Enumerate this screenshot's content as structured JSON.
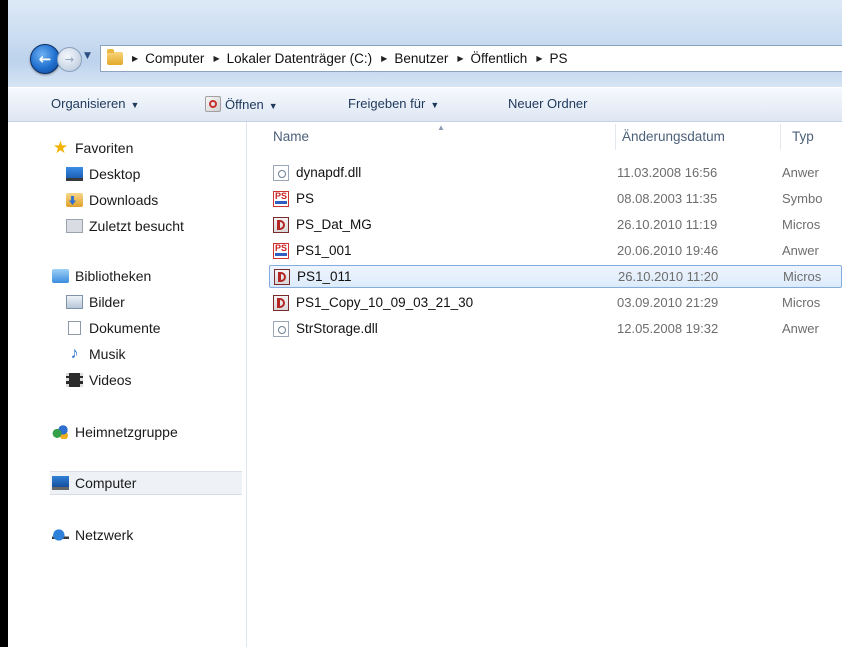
{
  "breadcrumb": [
    "Computer",
    "Lokaler Datenträger (C:)",
    "Benutzer",
    "Öffentlich",
    "PS"
  ],
  "toolbar": {
    "organize": "Organisieren",
    "open": "Öffnen",
    "share": "Freigeben für",
    "new_folder": "Neuer Ordner"
  },
  "nav": {
    "favorites": "Favoriten",
    "desktop": "Desktop",
    "downloads": "Downloads",
    "recent": "Zuletzt besucht",
    "libraries": "Bibliotheken",
    "pictures": "Bilder",
    "documents": "Dokumente",
    "music": "Musik",
    "videos": "Videos",
    "homegroup": "Heimnetzgruppe",
    "computer": "Computer",
    "network": "Netzwerk"
  },
  "columns": {
    "name": "Name",
    "date": "Änderungsdatum",
    "type": "Typ"
  },
  "files": [
    {
      "name": "dynapdf.dll",
      "date": "11.03.2008 16:56",
      "type": "Anwer",
      "icon": "dll-file-icon"
    },
    {
      "name": "PS",
      "date": "08.08.2003 11:35",
      "type": "Symbo",
      "icon": "ps-shortcut-icon"
    },
    {
      "name": "PS_Dat_MG",
      "date": "26.10.2010 11:19",
      "type": "Micros",
      "icon": "access-db-icon"
    },
    {
      "name": "PS1_001",
      "date": "20.06.2010 19:46",
      "type": "Anwer",
      "icon": "ps-app-icon"
    },
    {
      "name": "PS1_011",
      "date": "26.10.2010 11:20",
      "type": "Micros",
      "icon": "access-db-icon"
    },
    {
      "name": "PS1_Copy_10_09_03_21_30",
      "date": "03.09.2010 21:29",
      "type": "Micros",
      "icon": "access-db-icon"
    },
    {
      "name": "StrStorage.dll",
      "date": "12.05.2008 19:32",
      "type": "Anwer",
      "icon": "dll-file-icon"
    }
  ],
  "selected_file": "PS1_011"
}
